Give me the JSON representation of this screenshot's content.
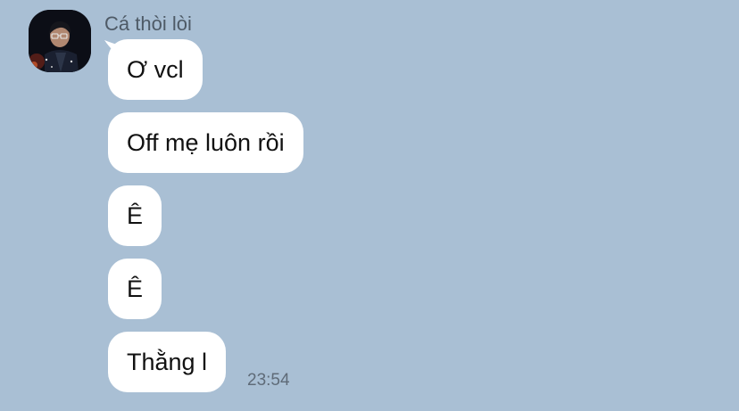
{
  "chat": {
    "sender": {
      "name": "Cá thòi lòi",
      "avatar": "avatar"
    },
    "messages": [
      {
        "text": "Ơ vcl"
      },
      {
        "text": "Off mẹ luôn rồi"
      },
      {
        "text": "Ê"
      },
      {
        "text": "Ê"
      },
      {
        "text": "Thằng l"
      }
    ],
    "last_timestamp": "23:54"
  },
  "colors": {
    "background": "#a9bfd4",
    "bubble": "#ffffff",
    "text": "#111111",
    "meta_text": "#5f6b78"
  }
}
